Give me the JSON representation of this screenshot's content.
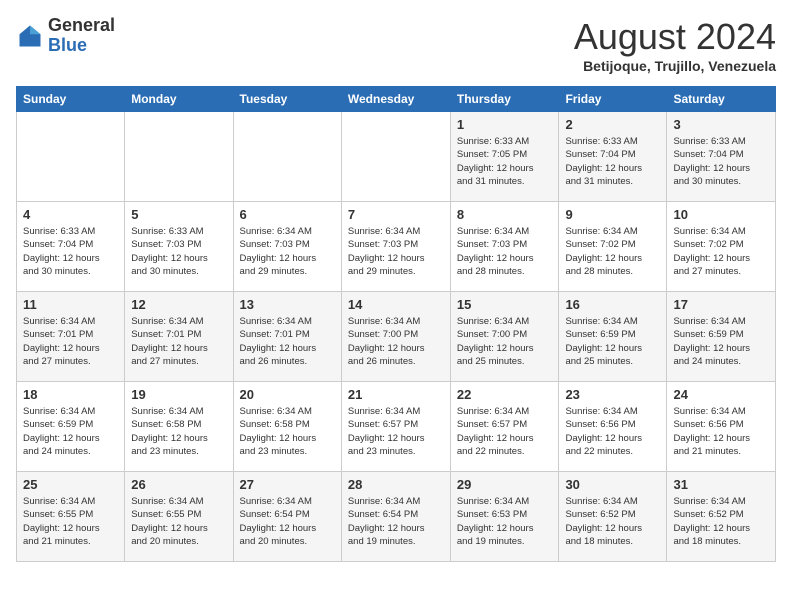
{
  "header": {
    "logo": {
      "general": "General",
      "blue": "Blue"
    },
    "title": "August 2024",
    "subtitle": "Betijoque, Trujillo, Venezuela"
  },
  "days_of_week": [
    "Sunday",
    "Monday",
    "Tuesday",
    "Wednesday",
    "Thursday",
    "Friday",
    "Saturday"
  ],
  "weeks": [
    [
      {
        "day": "",
        "info": ""
      },
      {
        "day": "",
        "info": ""
      },
      {
        "day": "",
        "info": ""
      },
      {
        "day": "",
        "info": ""
      },
      {
        "day": "1",
        "info": "Sunrise: 6:33 AM\nSunset: 7:05 PM\nDaylight: 12 hours\nand 31 minutes."
      },
      {
        "day": "2",
        "info": "Sunrise: 6:33 AM\nSunset: 7:04 PM\nDaylight: 12 hours\nand 31 minutes."
      },
      {
        "day": "3",
        "info": "Sunrise: 6:33 AM\nSunset: 7:04 PM\nDaylight: 12 hours\nand 30 minutes."
      }
    ],
    [
      {
        "day": "4",
        "info": "Sunrise: 6:33 AM\nSunset: 7:04 PM\nDaylight: 12 hours\nand 30 minutes."
      },
      {
        "day": "5",
        "info": "Sunrise: 6:33 AM\nSunset: 7:03 PM\nDaylight: 12 hours\nand 30 minutes."
      },
      {
        "day": "6",
        "info": "Sunrise: 6:34 AM\nSunset: 7:03 PM\nDaylight: 12 hours\nand 29 minutes."
      },
      {
        "day": "7",
        "info": "Sunrise: 6:34 AM\nSunset: 7:03 PM\nDaylight: 12 hours\nand 29 minutes."
      },
      {
        "day": "8",
        "info": "Sunrise: 6:34 AM\nSunset: 7:03 PM\nDaylight: 12 hours\nand 28 minutes."
      },
      {
        "day": "9",
        "info": "Sunrise: 6:34 AM\nSunset: 7:02 PM\nDaylight: 12 hours\nand 28 minutes."
      },
      {
        "day": "10",
        "info": "Sunrise: 6:34 AM\nSunset: 7:02 PM\nDaylight: 12 hours\nand 27 minutes."
      }
    ],
    [
      {
        "day": "11",
        "info": "Sunrise: 6:34 AM\nSunset: 7:01 PM\nDaylight: 12 hours\nand 27 minutes."
      },
      {
        "day": "12",
        "info": "Sunrise: 6:34 AM\nSunset: 7:01 PM\nDaylight: 12 hours\nand 27 minutes."
      },
      {
        "day": "13",
        "info": "Sunrise: 6:34 AM\nSunset: 7:01 PM\nDaylight: 12 hours\nand 26 minutes."
      },
      {
        "day": "14",
        "info": "Sunrise: 6:34 AM\nSunset: 7:00 PM\nDaylight: 12 hours\nand 26 minutes."
      },
      {
        "day": "15",
        "info": "Sunrise: 6:34 AM\nSunset: 7:00 PM\nDaylight: 12 hours\nand 25 minutes."
      },
      {
        "day": "16",
        "info": "Sunrise: 6:34 AM\nSunset: 6:59 PM\nDaylight: 12 hours\nand 25 minutes."
      },
      {
        "day": "17",
        "info": "Sunrise: 6:34 AM\nSunset: 6:59 PM\nDaylight: 12 hours\nand 24 minutes."
      }
    ],
    [
      {
        "day": "18",
        "info": "Sunrise: 6:34 AM\nSunset: 6:59 PM\nDaylight: 12 hours\nand 24 minutes."
      },
      {
        "day": "19",
        "info": "Sunrise: 6:34 AM\nSunset: 6:58 PM\nDaylight: 12 hours\nand 23 minutes."
      },
      {
        "day": "20",
        "info": "Sunrise: 6:34 AM\nSunset: 6:58 PM\nDaylight: 12 hours\nand 23 minutes."
      },
      {
        "day": "21",
        "info": "Sunrise: 6:34 AM\nSunset: 6:57 PM\nDaylight: 12 hours\nand 23 minutes."
      },
      {
        "day": "22",
        "info": "Sunrise: 6:34 AM\nSunset: 6:57 PM\nDaylight: 12 hours\nand 22 minutes."
      },
      {
        "day": "23",
        "info": "Sunrise: 6:34 AM\nSunset: 6:56 PM\nDaylight: 12 hours\nand 22 minutes."
      },
      {
        "day": "24",
        "info": "Sunrise: 6:34 AM\nSunset: 6:56 PM\nDaylight: 12 hours\nand 21 minutes."
      }
    ],
    [
      {
        "day": "25",
        "info": "Sunrise: 6:34 AM\nSunset: 6:55 PM\nDaylight: 12 hours\nand 21 minutes."
      },
      {
        "day": "26",
        "info": "Sunrise: 6:34 AM\nSunset: 6:55 PM\nDaylight: 12 hours\nand 20 minutes."
      },
      {
        "day": "27",
        "info": "Sunrise: 6:34 AM\nSunset: 6:54 PM\nDaylight: 12 hours\nand 20 minutes."
      },
      {
        "day": "28",
        "info": "Sunrise: 6:34 AM\nSunset: 6:54 PM\nDaylight: 12 hours\nand 19 minutes."
      },
      {
        "day": "29",
        "info": "Sunrise: 6:34 AM\nSunset: 6:53 PM\nDaylight: 12 hours\nand 19 minutes."
      },
      {
        "day": "30",
        "info": "Sunrise: 6:34 AM\nSunset: 6:52 PM\nDaylight: 12 hours\nand 18 minutes."
      },
      {
        "day": "31",
        "info": "Sunrise: 6:34 AM\nSunset: 6:52 PM\nDaylight: 12 hours\nand 18 minutes."
      }
    ]
  ]
}
